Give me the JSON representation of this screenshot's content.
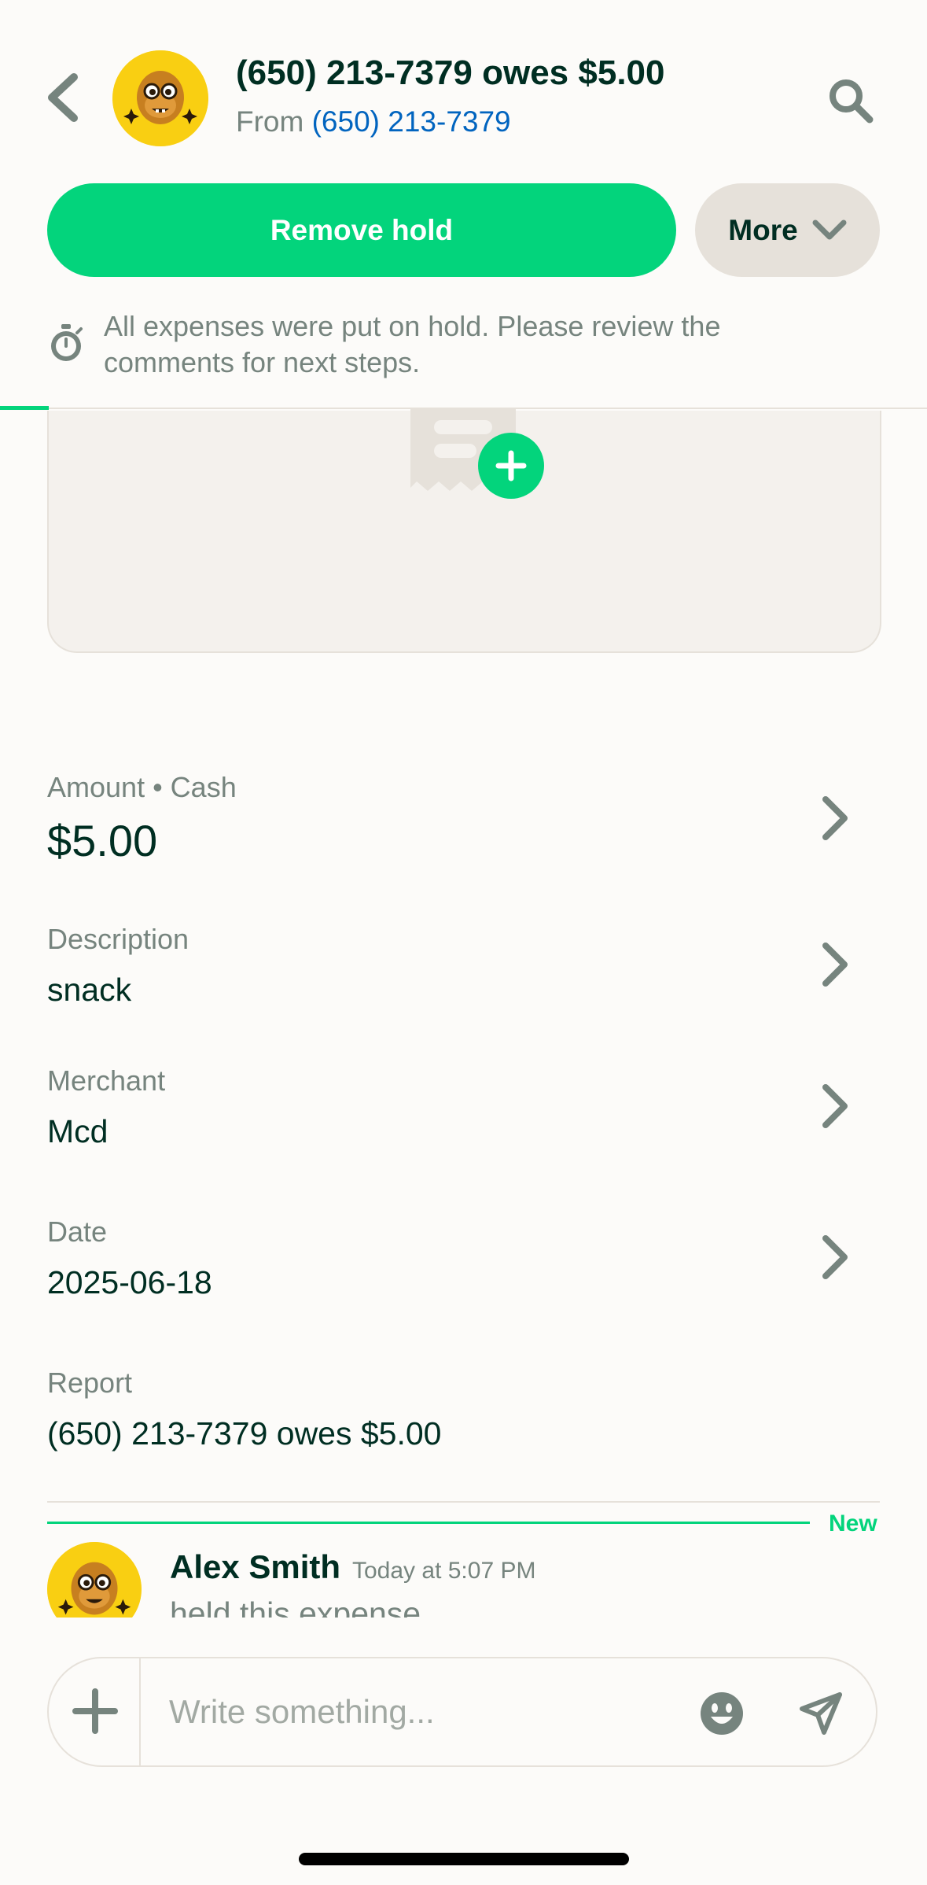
{
  "header": {
    "title": "(650) 213-7379 owes $5.00",
    "from_label": "From",
    "from_value": "(650) 213-7379"
  },
  "actions": {
    "remove_hold": "Remove hold",
    "more": "More"
  },
  "hold_banner": {
    "text": "All expenses were put on hold. Please review the comments for next steps."
  },
  "fields": {
    "amount": {
      "label": "Amount • Cash",
      "value": "$5.00"
    },
    "description": {
      "label": "Description",
      "value": "snack"
    },
    "merchant": {
      "label": "Merchant",
      "value": "Mcd"
    },
    "date": {
      "label": "Date",
      "value": "2025-06-18"
    },
    "report": {
      "label": "Report",
      "value": "(650) 213-7379 owes $5.00"
    }
  },
  "activity": {
    "new_label": "New",
    "author": "Alex Smith",
    "time": "Today at 5:07 PM",
    "text": "held this expense"
  },
  "composer": {
    "placeholder": "Write something..."
  },
  "colors": {
    "accent": "#03D47C",
    "link": "#0164BF",
    "text": "#002E22",
    "muted": "#76847E",
    "background": "#FCFBF9"
  },
  "icons": [
    "back-arrow-icon",
    "search-icon",
    "chevron-down-icon",
    "stopwatch-icon",
    "receipt-icon",
    "plus-icon",
    "chevron-right-icon",
    "emoji-icon",
    "send-icon"
  ]
}
